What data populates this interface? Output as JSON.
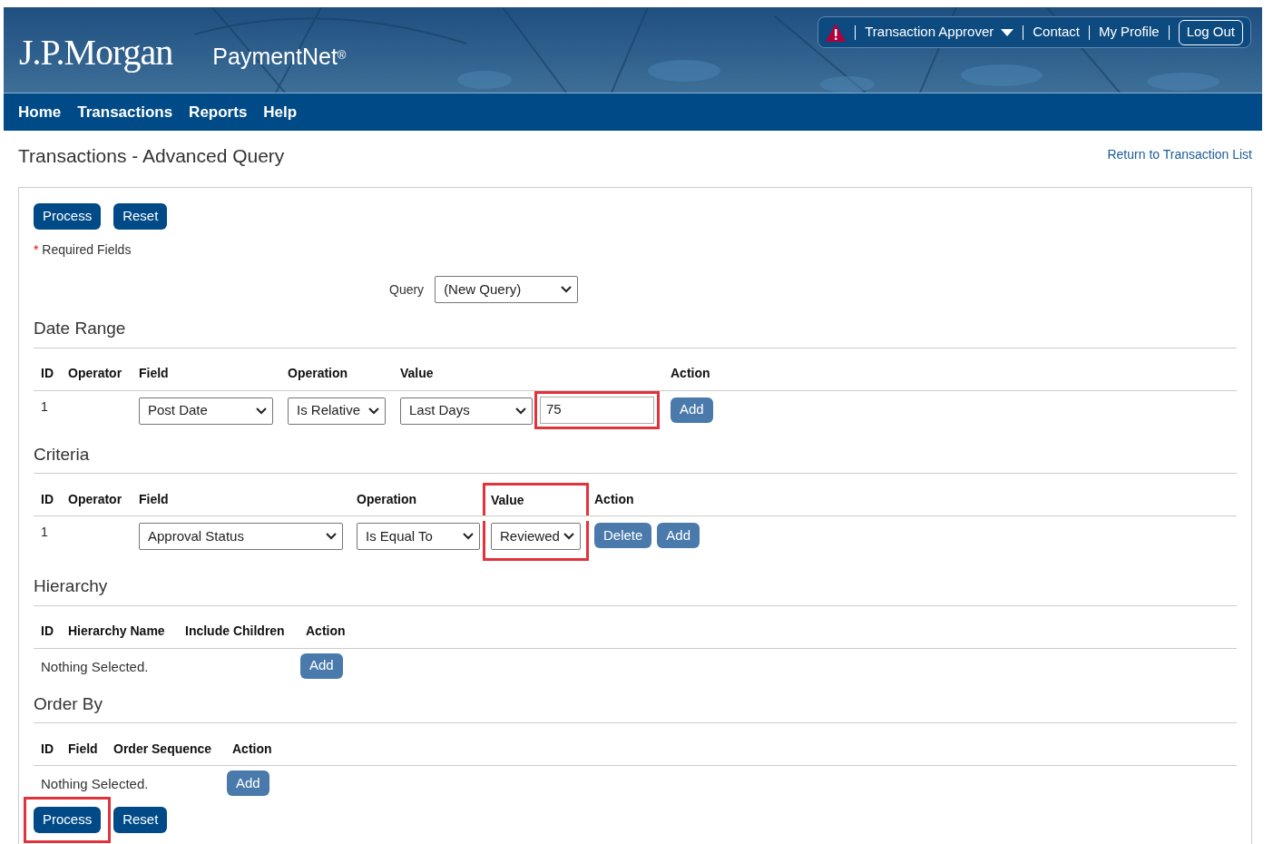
{
  "header": {
    "logo": "J.P.Morgan",
    "product": "PaymentNet",
    "product_mark": "®",
    "utility": [
      {
        "kind": "alert"
      },
      {
        "kind": "dropdown",
        "label": "Transaction Approver"
      },
      {
        "kind": "link",
        "label": "Contact"
      },
      {
        "kind": "link",
        "label": "My Profile"
      },
      {
        "kind": "button",
        "label": "Log Out"
      }
    ]
  },
  "nav": [
    "Home",
    "Transactions",
    "Reports",
    "Help"
  ],
  "page": {
    "title": "Transactions - Advanced Query",
    "return_link": "Return to Transaction List"
  },
  "top_buttons": [
    {
      "label": "Process",
      "highlighted": false
    },
    {
      "label": "Reset",
      "highlighted": false
    }
  ],
  "required_note": {
    "mark": "*",
    "text": "Required Fields"
  },
  "query": {
    "label": "Query",
    "value": "(New Query)"
  },
  "sections": [
    {
      "title": "Date Range",
      "columns": [
        {
          "label": "ID",
          "highlighted": false
        },
        {
          "label": "Operator",
          "highlighted": false
        },
        {
          "label": "Field",
          "highlighted": false
        },
        {
          "label": "Operation",
          "highlighted": false
        },
        {
          "label": "Value",
          "highlighted": false
        },
        {
          "label": "Action",
          "highlighted": false
        }
      ],
      "rows": [
        {
          "kind": "row",
          "cells": [
            [
              {
                "kind": "text",
                "value": "1"
              }
            ],
            [],
            [
              {
                "kind": "select",
                "value": "Post Date"
              }
            ],
            [
              {
                "kind": "select",
                "value": "Is Relative"
              }
            ],
            [
              {
                "kind": "select",
                "value": "Last Days"
              },
              {
                "kind": "input",
                "value": "75",
                "highlighted": true
              }
            ],
            [
              {
                "kind": "button",
                "value": "Add"
              }
            ]
          ]
        }
      ]
    },
    {
      "title": "Criteria",
      "columns": [
        {
          "label": "ID",
          "highlighted": false
        },
        {
          "label": "Operator",
          "highlighted": false
        },
        {
          "label": "Field",
          "highlighted": false
        },
        {
          "label": "Operation",
          "highlighted": false
        },
        {
          "label": "Value",
          "highlighted": true
        },
        {
          "label": "Action",
          "highlighted": false
        }
      ],
      "rows": [
        {
          "kind": "row",
          "cells": [
            [
              {
                "kind": "text",
                "value": "1"
              }
            ],
            [],
            [
              {
                "kind": "select",
                "value": "Approval Status"
              }
            ],
            [
              {
                "kind": "select",
                "value": "Is Equal To"
              }
            ],
            [
              {
                "kind": "select",
                "value": "Reviewed"
              }
            ],
            [
              {
                "kind": "button",
                "value": "Delete"
              },
              {
                "kind": "button",
                "value": "Add"
              }
            ]
          ]
        }
      ]
    },
    {
      "title": "Hierarchy",
      "columns": [
        {
          "label": "ID",
          "highlighted": false
        },
        {
          "label": "Hierarchy Name",
          "highlighted": false
        },
        {
          "label": "Include Children",
          "highlighted": false
        },
        {
          "label": "Action",
          "highlighted": false
        }
      ],
      "rows": [
        {
          "kind": "empty",
          "text": "Nothing Selected.",
          "button": "Add"
        }
      ]
    },
    {
      "title": "Order By",
      "columns": [
        {
          "label": "ID",
          "highlighted": false
        },
        {
          "label": "Field",
          "highlighted": false
        },
        {
          "label": "Order Sequence",
          "highlighted": false
        },
        {
          "label": "Action",
          "highlighted": false
        }
      ],
      "rows": [
        {
          "kind": "empty",
          "text": "Nothing Selected.",
          "button": "Add"
        }
      ]
    }
  ],
  "bottom_buttons": [
    {
      "label": "Process",
      "highlighted": true
    },
    {
      "label": "Reset",
      "highlighted": false
    }
  ]
}
